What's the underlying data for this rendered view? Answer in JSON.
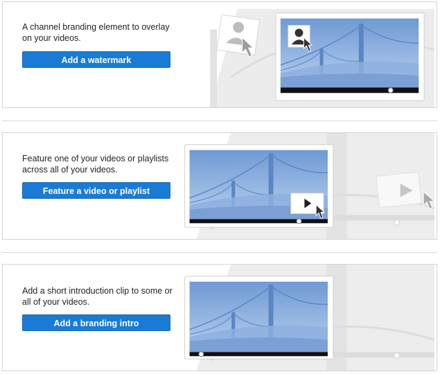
{
  "watermark_section": {
    "description": "A channel branding element to overlay on your videos.",
    "button_label": "Add a watermark"
  },
  "featured_section": {
    "description": "Feature one of your videos or playlists across all of your videos.",
    "button_label": "Feature a video or playlist"
  },
  "intro_section": {
    "description": "Add a short introduction clip to some or all of your videos.",
    "button_label": "Add a branding intro"
  },
  "colors": {
    "button_blue": "#1a7bd6",
    "video_sky": "#7fa7d9",
    "progress_bar": "#111111"
  },
  "icons": [
    "user-silhouette-icon",
    "mouse-cursor-icon",
    "play-icon",
    "progress-scrubber-icon"
  ]
}
